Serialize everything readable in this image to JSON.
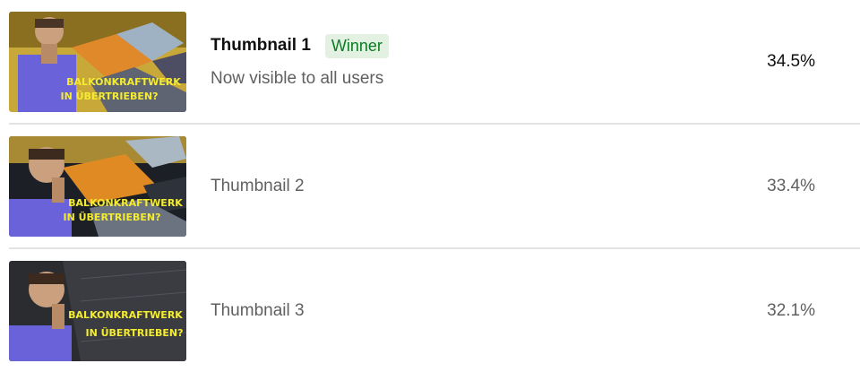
{
  "rows": [
    {
      "title": "Thumbnail 1",
      "badge": "Winner",
      "subtitle": "Now visible to all users",
      "percent": "34.5%",
      "thumb_text": [
        "BALKONKRAFTWERK",
        "IN ÜBERTRIEBEN?"
      ]
    },
    {
      "title": "Thumbnail 2",
      "percent": "33.4%",
      "thumb_text": [
        "BALKONKRAFTWERK",
        "IN ÜBERTRIEBEN?"
      ]
    },
    {
      "title": "Thumbnail 3",
      "percent": "32.1%",
      "thumb_text": [
        "BALKONKRAFTWERK",
        "IN ÜBERTRIEBEN?"
      ]
    }
  ]
}
